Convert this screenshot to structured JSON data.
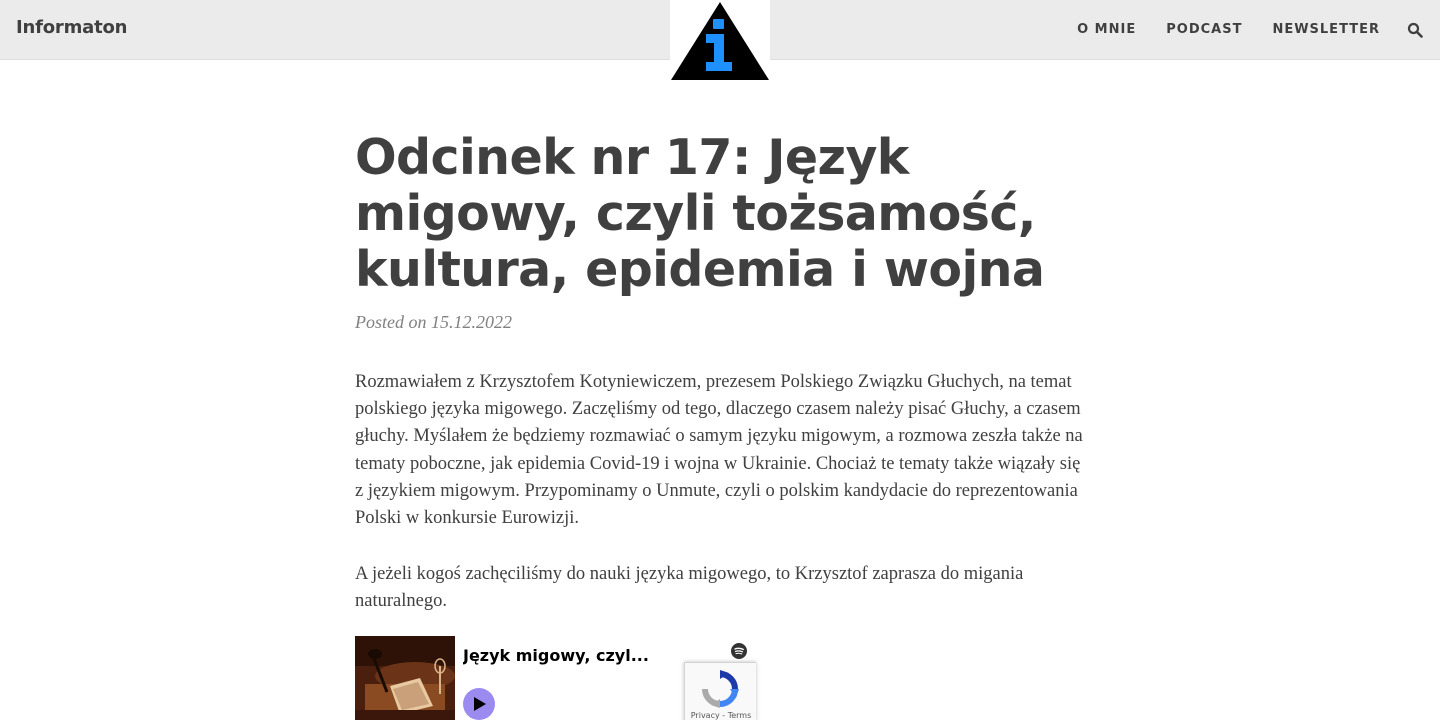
{
  "header": {
    "brand": "Informaton",
    "logo_icon": "info-triangle-logo",
    "nav": [
      {
        "label": "O MNIE"
      },
      {
        "label": "PODCAST"
      },
      {
        "label": "NEWSLETTER"
      }
    ],
    "search_icon": "search-icon"
  },
  "article": {
    "title": "Odcinek nr 17: Język migowy, czyli tożsamość, kultura, epidemia i wojna",
    "posted": "Posted on 15.12.2022",
    "paragraphs": [
      "Rozmawiałem z Krzysztofem Kotyniewiczem, prezesem Polskiego Związku Głuchych, na temat polskiego języka migowego. Zaczęliśmy od tego, dlaczego czasem należy pisać Głuchy, a czasem głuchy. Myślałem że będziemy rozmawiać o samym języku migowym, a rozmowa zeszła także na tematy poboczne, jak epidemia Covid-19 i wojna w Ukrainie. Chociaż te tematy także wiązały się z językiem migowym. Przypominamy o Unmute, czyli o polskim kandydacie do reprezentowania Polski w konkursie Eurowizji.",
      "A jeżeli kogoś zachęciliśmy do nauki języka migowego, to Krzysztof zaprasza do migania naturalnego."
    ]
  },
  "player": {
    "episode_title": "Język migowy, czyl...",
    "play_icon": "play-icon",
    "provider_icon": "spotify-icon"
  },
  "recaptcha": {
    "links": "Privacy - Terms"
  },
  "colors": {
    "header_bg": "#ebebeb",
    "text": "#404040",
    "logo_blue": "#1e90ff",
    "play_button": "#9b8bf0"
  }
}
